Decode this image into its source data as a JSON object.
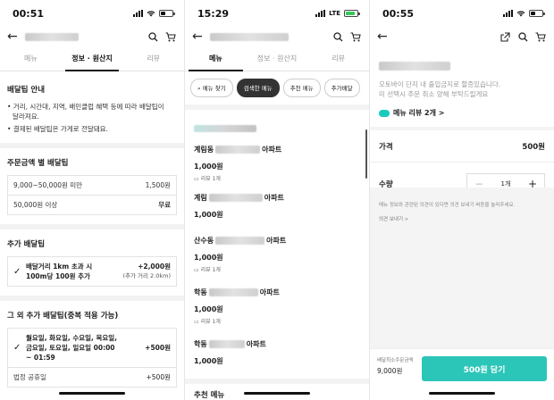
{
  "panel1": {
    "status_time": "00:51",
    "tabs": [
      "메뉴",
      "정보 · 원산지",
      "리뷰"
    ],
    "delivery_info": {
      "title": "배달팁 안내",
      "bullets": [
        "• 거리, 시간대, 지역, 배민클럽 혜택 등에 따라 배달팁이",
        "  달라져요.",
        "• 결제된 배달팁은 가게로 전달돼요."
      ]
    },
    "by_amount": {
      "title": "주문금액 별 배달팁",
      "rows": [
        {
          "range": "9,000~50,000원 미만",
          "fee": "1,500원"
        },
        {
          "range": "50,000원 이상",
          "fee": "무료"
        }
      ]
    },
    "extra": {
      "title": "추가 배달팁",
      "line1": "배달거리 1km 초과 시",
      "line2": "100m당 100원 추가",
      "amount": "+2,000원",
      "amount_note": "(추가 거리 2.0km)"
    },
    "other": {
      "title": "그 외 추가 배달팁(중복 적용 가능)",
      "line1": "월요일, 화요일, 수요일, 목요일,",
      "line2": "금요일, 토요일, 일요일 00:00",
      "line3": "~ 01:59",
      "amount": "+500원",
      "holiday_label": "법정 공휴일",
      "holiday_amount": "+500원"
    }
  },
  "panel2": {
    "status_time": "15:29",
    "lte": "LTE",
    "tabs": [
      "메뉴",
      "정보 · 원산지",
      "리뷰"
    ],
    "chips": [
      "메뉴 찾기",
      "검색한 메뉴",
      "추천 메뉴",
      "추가배달"
    ],
    "items": [
      {
        "prefix": "계림동",
        "suffix": "아파트",
        "price": "1,000원",
        "reviews": "리뷰 1개"
      },
      {
        "prefix": "계림",
        "suffix": "아파트",
        "price": "1,000원",
        "reviews": ""
      },
      {
        "prefix": "산수동",
        "suffix": "아파트",
        "price": "1,000원",
        "reviews": "리뷰 1개"
      },
      {
        "prefix": "학동",
        "suffix": "아파트",
        "price": "1,000원",
        "reviews": "리뷰 1개"
      },
      {
        "prefix": "학동",
        "suffix": "아파트",
        "price": "1,000원",
        "reviews": ""
      }
    ],
    "bottom_label": "추천 메뉴"
  },
  "panel3": {
    "status_time": "00:55",
    "desc_line1": "오토바이 단지 내 출입금지로 할증있습니다.",
    "desc_line2": "미 선택시 주문 취소 양해 부탁드릴게요",
    "review_link": "메뉴 리뷰 2개 >",
    "price_label": "가격",
    "price_value": "500원",
    "qty_label": "수량",
    "qty_value": "1개",
    "info_text": "메뉴 정보와 관련된 의견이 있다면 의견 보내기 버튼을 눌러주세요.",
    "feedback_link": "의견 보내기 >",
    "min_label": "배달최소주문금액",
    "min_value": "9,000원",
    "cta_label": "500원 담기"
  }
}
